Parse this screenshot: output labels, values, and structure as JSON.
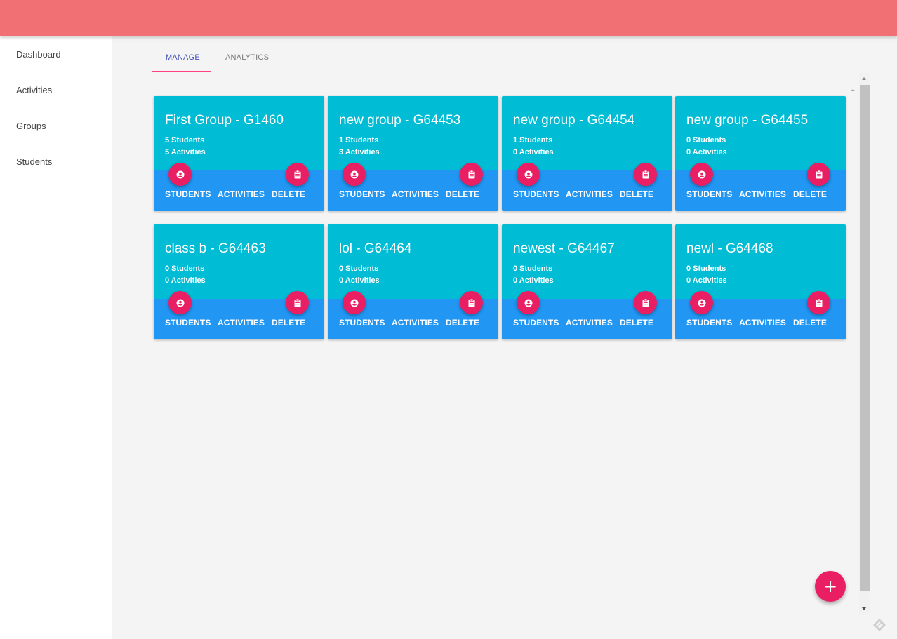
{
  "colors": {
    "topbar": "#f07073",
    "card_top": "#00bcd4",
    "card_bottom": "#2196f3",
    "accent": "#e91e63",
    "tab_active": "#3f51b5",
    "tab_indicator": "#ff4081"
  },
  "sidebar": {
    "items": [
      {
        "label": "Dashboard"
      },
      {
        "label": "Activities"
      },
      {
        "label": "Groups"
      },
      {
        "label": "Students"
      }
    ]
  },
  "tabs": [
    {
      "label": "MANAGE",
      "active": true
    },
    {
      "label": "ANALYTICS",
      "active": false
    }
  ],
  "card_actions": {
    "students": "STUDENTS",
    "activities": "ACTIVITIES",
    "delete": "DELETE",
    "left_icon": "account-circle-icon",
    "right_icon": "clipboard-icon"
  },
  "groups": [
    {
      "title": "First Group - G1460",
      "students": "5 Students",
      "activities": "5 Activities"
    },
    {
      "title": "new group - G64453",
      "students": "1 Students",
      "activities": "3 Activities"
    },
    {
      "title": "new group - G64454",
      "students": "1 Students",
      "activities": "0 Activities"
    },
    {
      "title": "new group - G64455",
      "students": "0 Students",
      "activities": "0 Activities"
    },
    {
      "title": "class b - G64463",
      "students": "0 Students",
      "activities": "0 Activities"
    },
    {
      "title": "lol - G64464",
      "students": "0 Students",
      "activities": "0 Activities"
    },
    {
      "title": "newest - G64467",
      "students": "0 Students",
      "activities": "0 Activities"
    },
    {
      "title": "newl - G64468",
      "students": "0 Students",
      "activities": "0 Activities"
    }
  ],
  "fab": {
    "label": "+",
    "icon": "add-icon"
  }
}
